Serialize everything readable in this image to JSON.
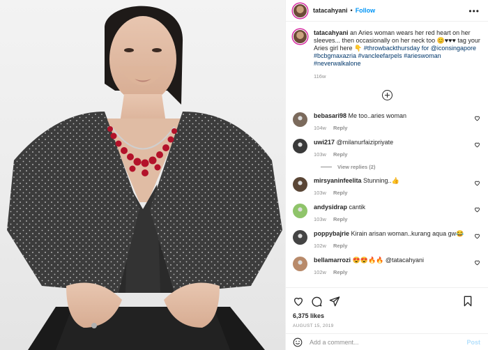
{
  "post": {
    "username": "tatacahyani",
    "follow_label": "Follow",
    "more_label": "•••",
    "caption": {
      "username": "tatacahyani",
      "text": " an Aries woman wears her red heart on her sleeves... then occasionally on her neck too 😊♥♥♥ tag your Aries girl here 👇",
      "tags": "#throwbackthursday for @iconsingapore #bcbgmaxazria #vancleefarpels #arieswoman #neverwalkalone",
      "time": "116w"
    },
    "comments": [
      {
        "username": "bebasari98",
        "text": " Me too..aries woman",
        "time": "104w",
        "reply": "Reply",
        "avatar_color": "#7b6a5c"
      },
      {
        "username": "uwi217",
        "text": " @milanurfaizipriyate",
        "time": "103w",
        "reply": "Reply",
        "avatar_color": "#3a3a3a",
        "view_replies": "View replies (2)"
      },
      {
        "username": "mirsyaninfeelita",
        "text": " Stunning..👍",
        "time": "103w",
        "reply": "Reply",
        "avatar_color": "#5a4636"
      },
      {
        "username": "andysidrap",
        "text": " cantik",
        "time": "103w",
        "reply": "Reply",
        "avatar_color": "#8fc46a"
      },
      {
        "username": "poppybajrie",
        "text": " Kirain arisan woman..kurang aqua gw😂",
        "time": "102w",
        "reply": "Reply",
        "avatar_color": "#444444"
      },
      {
        "username": "bellamarrozi",
        "text": " 😍😍🔥🔥 @tatacahyani",
        "time": "102w",
        "reply": "Reply",
        "avatar_color": "#b88a6a"
      }
    ],
    "likes": "6,375 likes",
    "date": "AUGUST 15, 2019",
    "add_comment_placeholder": "Add a comment...",
    "post_label": "Post",
    "colors": {
      "link": "#0095f6",
      "tag": "#00376b",
      "muted": "#8e8e8e"
    }
  }
}
